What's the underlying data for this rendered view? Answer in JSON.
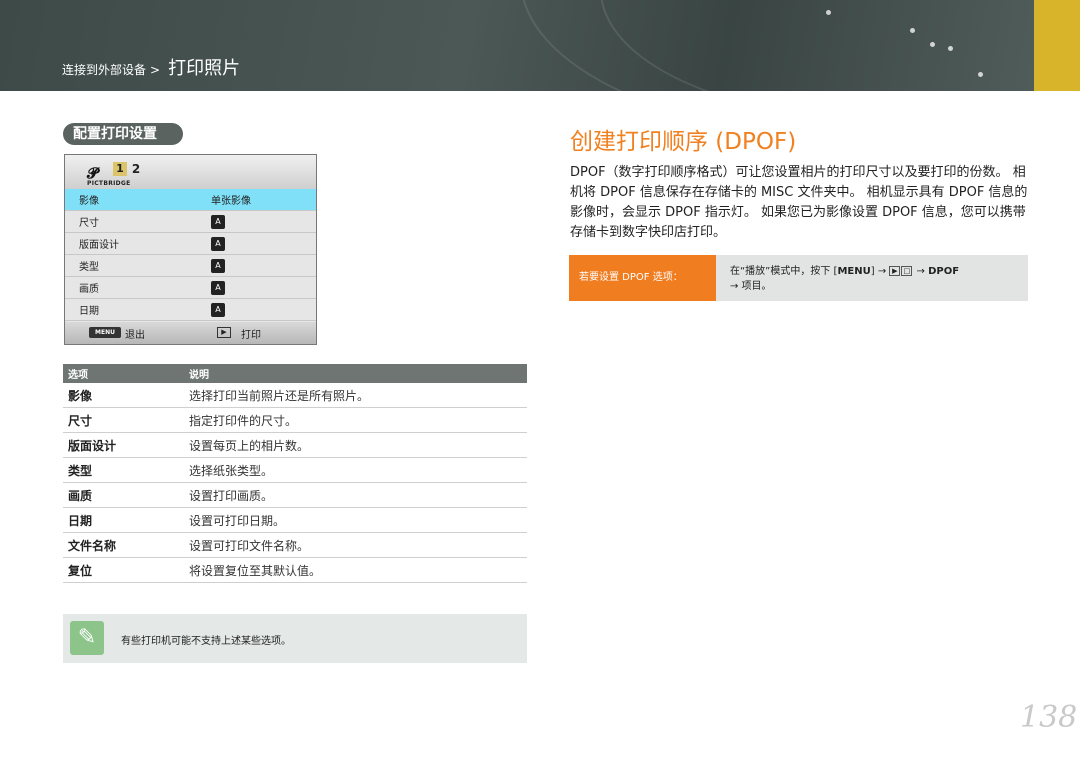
{
  "header": {
    "breadcrumb_parent": "连接到外部设备",
    "breadcrumb_sep": ">",
    "breadcrumb_current": "打印照片",
    "accent_color": "#d8b42a"
  },
  "left": {
    "section_title": "配置打印设置",
    "camera_screen": {
      "tab1": "1",
      "tab2": "2",
      "logo_text": "PICTBRIDGE",
      "rows": [
        {
          "label": "影像",
          "value": "单张影像",
          "icon": ""
        },
        {
          "label": "尺寸",
          "value": "",
          "icon": "size-icon"
        },
        {
          "label": "版面设计",
          "value": "",
          "icon": "layout-icon"
        },
        {
          "label": "类型",
          "value": "",
          "icon": "type-icon"
        },
        {
          "label": "画质",
          "value": "",
          "icon": "quality-icon"
        },
        {
          "label": "日期",
          "value": "",
          "icon": "date-icon"
        }
      ],
      "menu_key": "MENU",
      "exit_label": "退出",
      "print_label": "打印"
    },
    "table": {
      "headers": [
        "选项",
        "说明"
      ],
      "rows": [
        [
          "影像",
          "选择打印当前照片还是所有照片。"
        ],
        [
          "尺寸",
          "指定打印件的尺寸。"
        ],
        [
          "版面设计",
          "设置每页上的相片数。"
        ],
        [
          "类型",
          "选择纸张类型。"
        ],
        [
          "画质",
          "设置打印画质。"
        ],
        [
          "日期",
          "设置可打印日期。"
        ],
        [
          "文件名称",
          "设置可打印文件名称。"
        ],
        [
          "复位",
          "将设置复位至其默认值。"
        ]
      ]
    },
    "note": "有些打印机可能不支持上述某些选项。"
  },
  "right": {
    "title": "创建打印顺序 (DPOF)",
    "title_color": "#f08020",
    "paragraph": "DPOF（数字打印顺序格式）可让您设置相片的打印尺寸以及要打印的份数。 相机将 DPOF 信息保存在存储卡的 MISC 文件夹中。 相机显示具有 DPOF 信息的影像时，会显示 DPOF 指示灯。 如果您已为影像设置 DPOF 信息，您可以携带存储卡到数字快印店打印。",
    "callout_tag": "若要设置 DPOF 选项：",
    "callout_prefix": "在“播放”模式中，按下 [",
    "callout_menu": "MENU",
    "callout_arrow": "] → ",
    "callout_arrow2": " → ",
    "callout_dpof": "DPOF",
    "callout_line2": "→ 项目。"
  },
  "page_number": "138"
}
